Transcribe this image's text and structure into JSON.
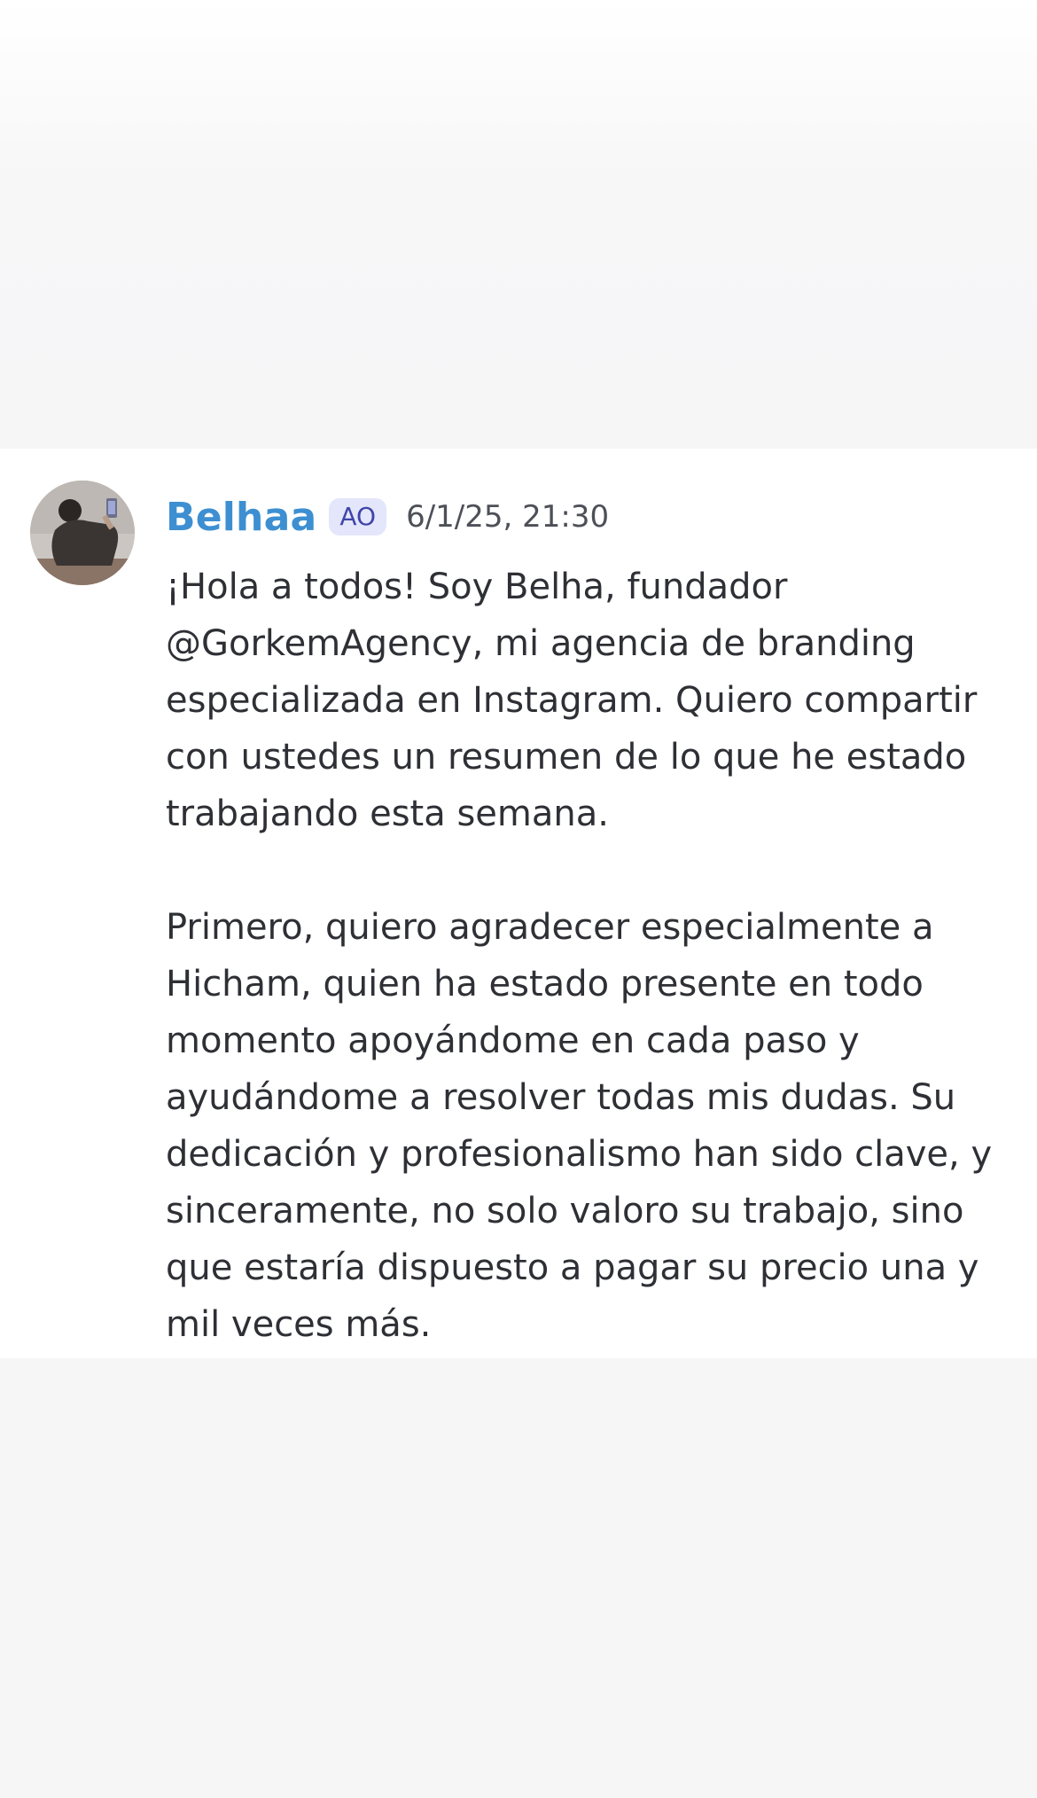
{
  "message": {
    "author": "Belhaa",
    "role_badge": "AO",
    "timestamp": "6/1/25, 21:30",
    "paragraphs": [
      "¡Hola a todos! Soy Belha, fundador @GorkemAgency, mi agencia de branding especializada en Instagram. Quiero compartir con ustedes un resumen de lo que he estado trabajando esta semana.",
      "Primero, quiero agradecer especialmente a Hicham, quien ha estado presente en todo momento apoyándome en cada paso y ayudándome a resolver todas mis dudas. Su dedicación y profesionalismo han sido clave, y sinceramente, no solo valoro su trabajo, sino que estaría dispuesto a pagar su precio una y mil veces más."
    ]
  },
  "colors": {
    "username": "#3d8fd1",
    "badge_bg": "#e4e6fb",
    "badge_text": "#3f46a8",
    "text": "#2e3035",
    "timestamp": "#4e5058",
    "background": "#f6f6f7",
    "card": "#ffffff"
  }
}
